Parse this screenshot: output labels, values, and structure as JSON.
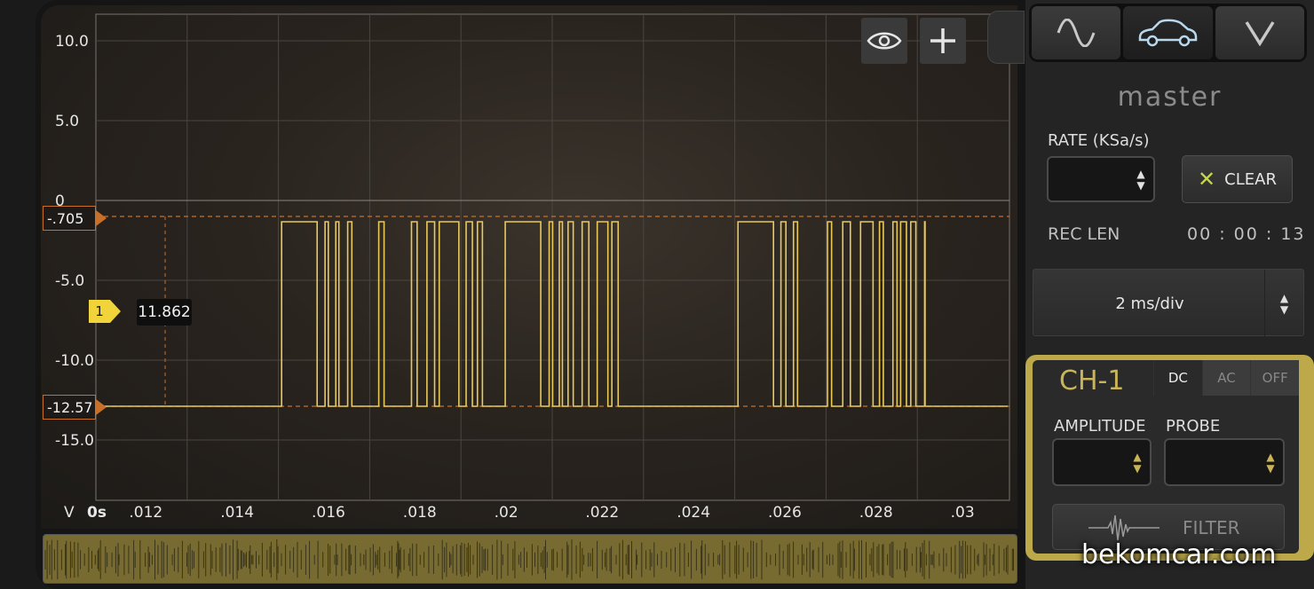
{
  "scope": {
    "y_ticks": [
      "10.0",
      "5.0",
      "0",
      "-5.0",
      "-10.0",
      "-15.0"
    ],
    "y_unit": "V",
    "x_ticks": [
      "0s",
      ".012",
      ".014",
      ".016",
      ".018",
      ".02",
      ".022",
      ".024",
      ".026",
      ".028",
      ".03"
    ],
    "marker_top": "-.705",
    "marker_bottom": "-12.57",
    "channel_badge": "1",
    "cursor_value": "11.862",
    "trace_color": "#e8c95a",
    "marker_color": "#c8702a",
    "signal_levels_v": [
      -0.705,
      -12.57
    ],
    "active_bursts": [
      {
        "start_s": 0.015,
        "end_s": 0.0194
      },
      {
        "start_s": 0.0199,
        "end_s": 0.0224
      },
      {
        "start_s": 0.025,
        "end_s": 0.0291
      }
    ]
  },
  "toolbar": {
    "eye_icon": "eye-icon",
    "plus_icon": "plus-icon"
  },
  "panel": {
    "mode_tabs": [
      {
        "icon": "sine-wave-icon",
        "active": false
      },
      {
        "icon": "car-icon",
        "active": true
      },
      {
        "icon": "chevron-v-icon",
        "active": false
      }
    ],
    "title": "master",
    "rate_label": "RATE (KSa/s)",
    "rate_value": "",
    "clear_label": "CLEAR",
    "reclen_label": "REC LEN",
    "reclen_value": "00 : 00 : 13",
    "timebase": "2 ms/div",
    "channel": {
      "title": "CH-1",
      "coupling": [
        "DC",
        "AC",
        "OFF"
      ],
      "coupling_selected": "DC",
      "amplitude_label": "AMPLITUDE",
      "probe_label": "PROBE",
      "amplitude_value": "",
      "probe_value": "",
      "filter_label": "FILTER",
      "accent_color": "#bda94a"
    }
  },
  "watermark": "bekomcar.com"
}
